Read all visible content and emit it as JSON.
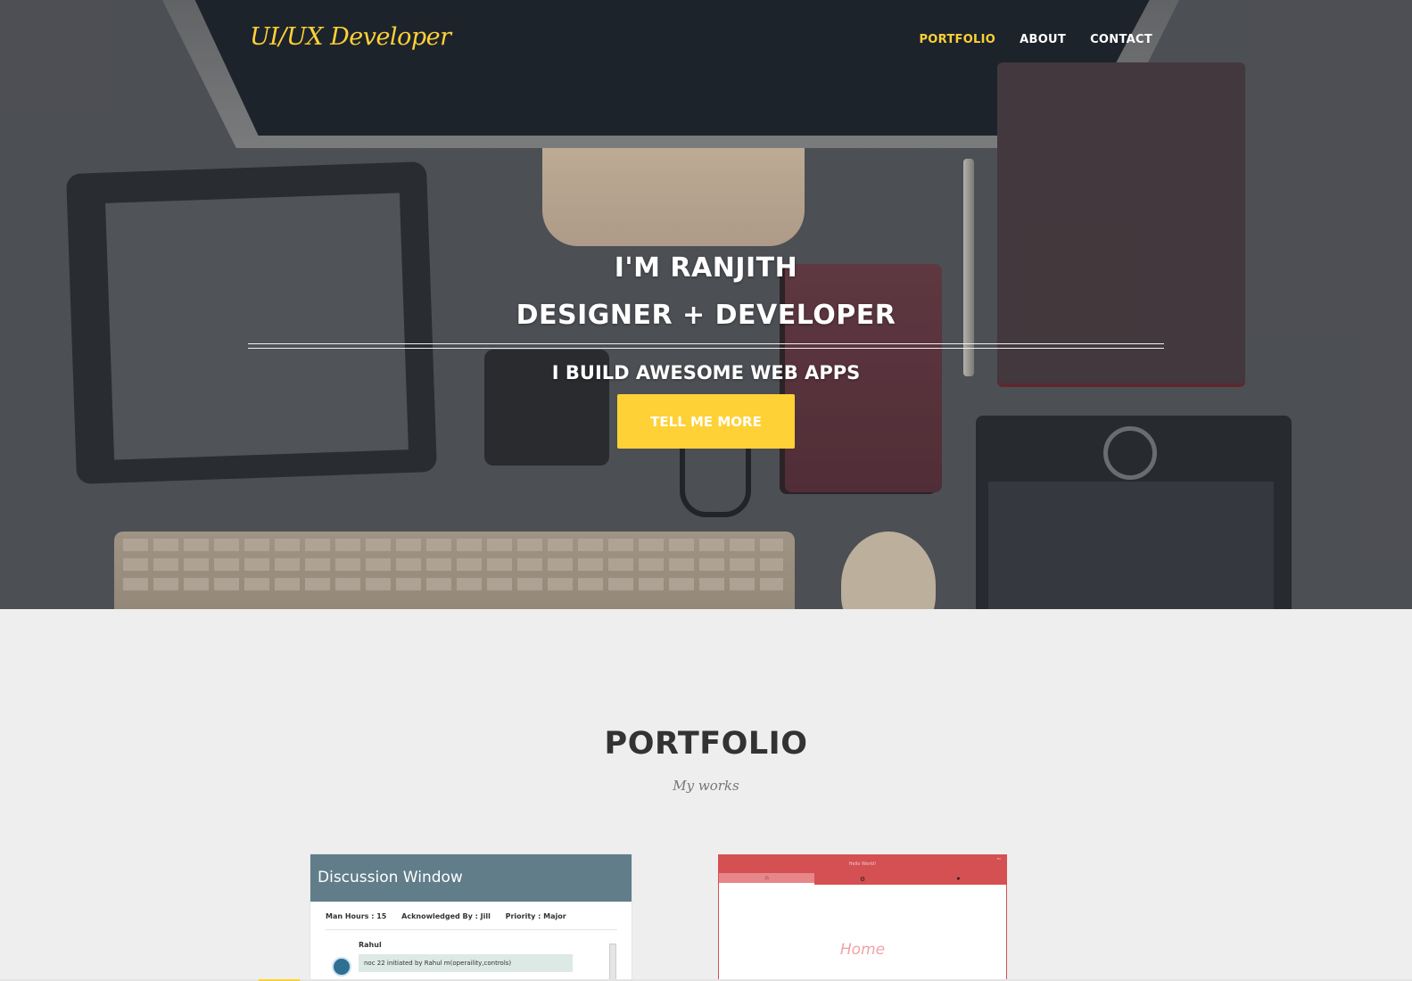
{
  "brand": "UI/UX Developer",
  "nav": {
    "items": [
      {
        "label": "PORTFOLIO",
        "active": true
      },
      {
        "label": "ABOUT",
        "active": false
      },
      {
        "label": "CONTACT",
        "active": false
      }
    ]
  },
  "hero": {
    "line1": "I'M RANJITH",
    "line2": "DESIGNER + DEVELOPER",
    "tagline": "I BUILD AWESOME WEB APPS",
    "cta_label": "TELL ME MORE"
  },
  "portfolio": {
    "title": "PORTFOLIO",
    "subtitle": "My works",
    "items": [
      {
        "title": "Discussion Window",
        "meta": [
          "Man Hours : 15",
          "Acknowledged By : Jill",
          "Priority : Major"
        ],
        "comment_author": "Rahul",
        "comment_text": "noc 22 initiated by Rahul m(operaility,controls)"
      },
      {
        "app_title": "Hello World!",
        "content_label": "Home"
      }
    ]
  },
  "colors": {
    "accent": "#fed136",
    "discussion_header": "#617d8a",
    "app_primary": "#d55052"
  }
}
